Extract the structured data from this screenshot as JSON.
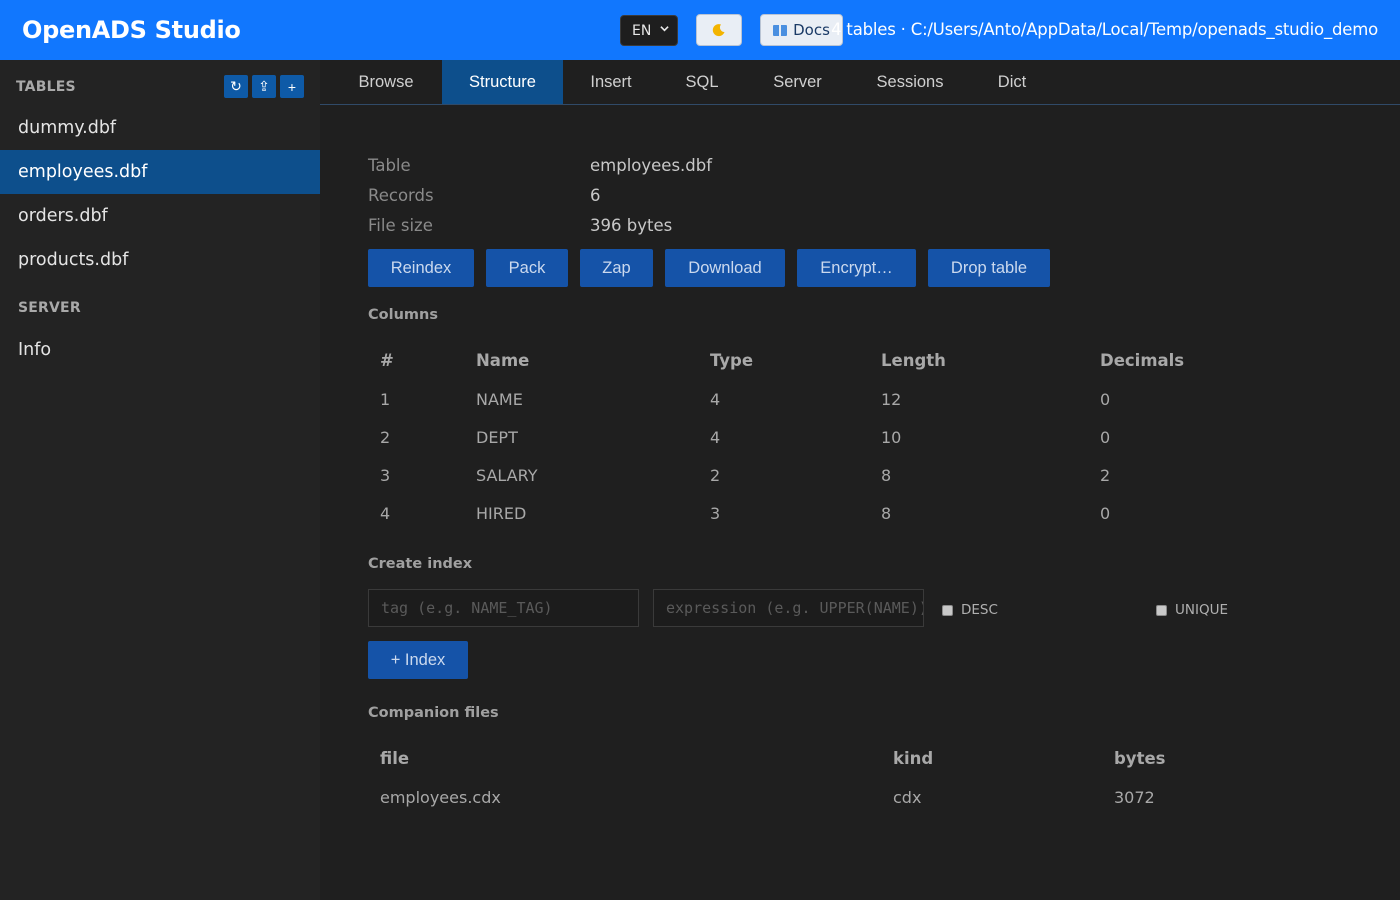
{
  "header": {
    "title": "OpenADS Studio",
    "lang": "EN",
    "theme_icon": "moon-icon",
    "docs_label": "Docs",
    "info": "4 tables · C:/Users/Anto/AppData/Local/Temp/openads_studio_demo"
  },
  "sidebar": {
    "tables_heading": "TABLES",
    "tools": [
      "↻",
      "⇪",
      "+"
    ],
    "tables": [
      "dummy.dbf",
      "employees.dbf",
      "orders.dbf",
      "products.dbf"
    ],
    "active_table": "employees.dbf",
    "server_heading": "SERVER",
    "server_items": [
      "Info"
    ]
  },
  "tabs": [
    "Browse",
    "Structure",
    "Insert",
    "SQL",
    "Server",
    "Sessions",
    "Dict"
  ],
  "active_tab": "Structure",
  "meta": {
    "table_label": "Table",
    "table_value": "employees.dbf",
    "records_label": "Records",
    "records_value": "6",
    "size_label": "File size",
    "size_value": "396 bytes"
  },
  "actions": [
    "Reindex",
    "Pack",
    "Zap",
    "Download",
    "Encrypt…",
    "Drop table"
  ],
  "columns": {
    "title": "Columns",
    "headers": [
      "#",
      "Name",
      "Type",
      "Length",
      "Decimals"
    ],
    "rows": [
      [
        "1",
        "NAME",
        "4",
        "12",
        "0"
      ],
      [
        "2",
        "DEPT",
        "4",
        "10",
        "0"
      ],
      [
        "3",
        "SALARY",
        "2",
        "8",
        "2"
      ],
      [
        "4",
        "HIRED",
        "3",
        "8",
        "0"
      ]
    ]
  },
  "create_index": {
    "title": "Create index",
    "tag_placeholder": "tag (e.g. NAME_TAG)",
    "expr_placeholder": "expression (e.g. UPPER(NAME))",
    "desc_label": "DESC",
    "unique_label": "UNIQUE",
    "button_label": "+ Index"
  },
  "companion": {
    "title": "Companion files",
    "headers": [
      "file",
      "kind",
      "bytes"
    ],
    "rows": [
      [
        "employees.cdx",
        "cdx",
        "3072"
      ]
    ]
  },
  "colors": {
    "header_bg": "#1177fe",
    "accent": "#0d4f8c",
    "button": "#1553a8"
  }
}
